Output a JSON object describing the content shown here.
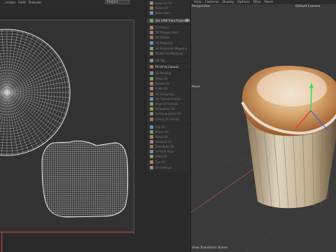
{
  "menu": {
    "items": [
      "...nction",
      "Field",
      "Textures"
    ],
    "dropdown": "Project"
  },
  "tools": [
    {
      "label": "Loops to UV",
      "bright": false
    },
    {
      "label": "Relax UV",
      "bright": false
    },
    {
      "label": "Relax Ratio",
      "bright": false
    },
    {
      "label": "Set UVW from Projection",
      "bright": true,
      "highlight": true,
      "gear": true
    },
    {
      "label": "UV Select",
      "bright": false
    },
    {
      "label": "UV Polygon Shell",
      "bright": false
    },
    {
      "label": "UV Seams",
      "bright": false
    },
    {
      "label": "UV Mapping",
      "bright": false
    },
    {
      "label": "UV Projection Mapping",
      "bright": false
    },
    {
      "label": "Delete UV Mapping",
      "bright": false
    },
    {
      "label": "UV Tag",
      "bright": false
    },
    {
      "label": "Fit UV to Canvas",
      "bright": true
    },
    {
      "label": "UV Packing",
      "bright": false
    },
    {
      "label": "Move UV",
      "bright": false
    },
    {
      "label": "Rotate UV",
      "bright": false
    },
    {
      "label": "Scale UV",
      "bright": false
    },
    {
      "label": "UV Snapping",
      "bright": false
    },
    {
      "label": "UV Transformation",
      "bright": false
    },
    {
      "label": "Align UV Islands",
      "bright": false
    },
    {
      "label": "Straighten UV",
      "bright": false
    },
    {
      "label": "Rectangularize UV",
      "bright": false
    },
    {
      "label": "Orient UV Islands",
      "bright": false
    },
    {
      "label": "Flip UV",
      "bright": false
    },
    {
      "label": "Mirror UV",
      "bright": false
    },
    {
      "label": "Stack UV",
      "bright": false
    },
    {
      "label": "Unstack UV",
      "bright": false
    },
    {
      "label": "Distribute UV",
      "bright": false
    },
    {
      "label": "UV Grid Align",
      "bright": false
    },
    {
      "label": "Weld UV",
      "bright": false
    },
    {
      "label": "Cut UV",
      "bright": false
    },
    {
      "label": "UV Settings",
      "bright": false
    }
  ],
  "viewport": {
    "menu": [
      "View",
      "Cameras",
      "Display",
      "Options",
      "Filter",
      "Panel"
    ],
    "projection": "Perspective",
    "camera": "Default Camera",
    "move_label": "Move",
    "status": "View Transform: Scene"
  },
  "colors": {
    "accent": "#c44444",
    "y_axis": "#3cdc5a",
    "x_axis": "#e04040",
    "wire": "#e6e6e6"
  }
}
